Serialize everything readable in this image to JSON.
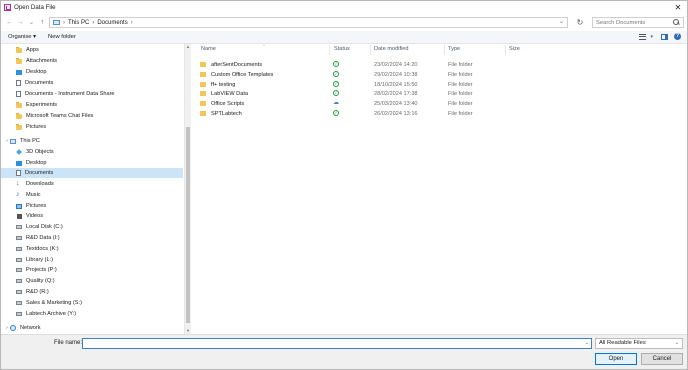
{
  "window": {
    "title": "Open Data File",
    "close_glyph": "✕"
  },
  "nav_buttons": {
    "back": "←",
    "forward": "→",
    "recent": "⌄",
    "up": "↑",
    "refresh": "↻"
  },
  "address": {
    "crumbs": [
      "This PC",
      "Documents"
    ],
    "separator": "›",
    "dropdown": "⌄"
  },
  "search": {
    "placeholder": "Search Documents"
  },
  "toolbar": {
    "organise": "Organise ▾",
    "new_folder": "New folder",
    "view_drop": "▾",
    "help": "?"
  },
  "sidebar": {
    "quick_access": [
      {
        "label": "Apps",
        "icon": "folder-icon"
      },
      {
        "label": "Attachments",
        "icon": "folder-icon"
      },
      {
        "label": "Desktop",
        "icon": "desktop-icon"
      },
      {
        "label": "Documents",
        "icon": "document-icon"
      },
      {
        "label": "Documents - Instrument Data Share",
        "icon": "document-icon"
      },
      {
        "label": "Experiments",
        "icon": "folder-icon"
      },
      {
        "label": "Microsoft Teams Chat Files",
        "icon": "folder-icon"
      },
      {
        "label": "Pictures",
        "icon": "folder-icon"
      }
    ],
    "this_pc": {
      "label": "This PC",
      "expand": "›"
    },
    "this_pc_items": [
      {
        "label": "3D Objects",
        "icon": "cube-icon"
      },
      {
        "label": "Desktop",
        "icon": "desktop-icon"
      },
      {
        "label": "Documents",
        "icon": "document-icon",
        "selected": true
      },
      {
        "label": "Downloads",
        "icon": "download-icon"
      },
      {
        "label": "Music",
        "icon": "music-icon"
      },
      {
        "label": "Pictures",
        "icon": "pictures-icon"
      },
      {
        "label": "Videos",
        "icon": "video-icon"
      },
      {
        "label": "Local Disk (C:)",
        "icon": "drive-icon"
      },
      {
        "label": "R&D Data (I:)",
        "icon": "network-drive-icon"
      },
      {
        "label": "Textdocs (K:)",
        "icon": "network-drive-icon"
      },
      {
        "label": "Library (L:)",
        "icon": "network-drive-icon"
      },
      {
        "label": "Projects (P:)",
        "icon": "network-drive-icon"
      },
      {
        "label": "Quality (Q:)",
        "icon": "network-drive-icon"
      },
      {
        "label": "R&D (R:)",
        "icon": "network-drive-icon"
      },
      {
        "label": "Sales & Marketing (S:)",
        "icon": "network-drive-icon"
      },
      {
        "label": "Labtech Archive (Y:)",
        "icon": "network-drive-icon"
      }
    ],
    "network": {
      "label": "Network",
      "expand": "›"
    }
  },
  "columns": {
    "name": "Name",
    "status": "Status",
    "date": "Date modified",
    "type": "Type",
    "size": "Size",
    "sort_caret": "^"
  },
  "files": [
    {
      "name": "afterSentDocuments",
      "status": "synced",
      "date": "23/02/2024 14:20",
      "type": "File folder"
    },
    {
      "name": "Custom Office Templates",
      "status": "synced",
      "date": "29/02/2024 10:38",
      "type": "File folder"
    },
    {
      "name": "ff+ testing",
      "status": "synced",
      "date": "18/10/2024 15:50",
      "type": "File folder"
    },
    {
      "name": "LabVIEW Data",
      "status": "synced",
      "date": "28/02/2024 17:38",
      "type": "File folder"
    },
    {
      "name": "Office Scripts",
      "status": "cloud",
      "date": "25/03/2024 13:40",
      "type": "File folder"
    },
    {
      "name": "SPTLabtech",
      "status": "synced",
      "date": "26/02/2024 13:16",
      "type": "File folder"
    }
  ],
  "status_glyphs": {
    "synced": "✓",
    "cloud": "☁"
  },
  "footer": {
    "file_name_label": "File name:",
    "file_name_value": "",
    "filter_value": "All Readable Files",
    "open_label": "Open",
    "cancel_label": "Cancel"
  }
}
